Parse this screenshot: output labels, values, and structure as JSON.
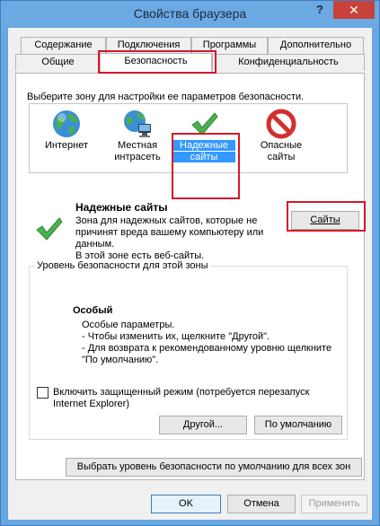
{
  "window": {
    "title": "Свойства браузера",
    "help_glyph": "?",
    "close_glyph": "✕"
  },
  "tabs": {
    "row_top": [
      "Содержание",
      "Подключения",
      "Программы",
      "Дополнительно"
    ],
    "row_bottom": [
      "Общие",
      "Безопасность",
      "Конфиденциальность"
    ],
    "active": "Безопасность"
  },
  "security": {
    "instruction": "Выберите зону для настройки ее параметров безопасности.",
    "zones": [
      {
        "label_1": "Интернет",
        "label_2": "",
        "icon": "globe-icon"
      },
      {
        "label_1": "Местная",
        "label_2": "интрасеть",
        "icon": "intranet-icon"
      },
      {
        "label_1": "Надежные",
        "label_2": "сайты",
        "icon": "checkmark-icon",
        "selected": true
      },
      {
        "label_1": "Опасные",
        "label_2": "сайты",
        "icon": "prohibited-icon"
      }
    ],
    "zone_title": "Надежные сайты",
    "zone_desc_1": "Зона для надежных сайтов, которые не",
    "zone_desc_2": "причинят вреда вашему компьютеру или",
    "zone_desc_3": "данным.",
    "zone_desc_4": "В этой зоне есть веб-сайты.",
    "sites_button": "Сайты",
    "level_group_title": "Уровень безопасности для этой зоны",
    "level_title": "Особый",
    "level_line_1": "Особые параметры.",
    "level_line_2": "- Чтобы изменить их, щелкните \"Другой\".",
    "level_line_3": "- Для возврата к рекомендованному уровню щелкните",
    "level_line_4": "\"По умолчанию\".",
    "protected_mode_1": "Включить защищенный режим (потребуется перезапуск",
    "protected_mode_2": "Internet Explorer)",
    "protected_mode_checked": false,
    "custom_button": "Другой...",
    "default_button": "По умолчанию",
    "reset_all_button": "Выбрать уровень безопасности по умолчанию для всех зон"
  },
  "footer": {
    "ok": "OK",
    "cancel": "Отмена",
    "apply": "Применить"
  },
  "colors": {
    "titlebar": "#6aa9e2",
    "close": "#c8423a",
    "highlight": "#d6182b",
    "selection": "#3399ff"
  }
}
